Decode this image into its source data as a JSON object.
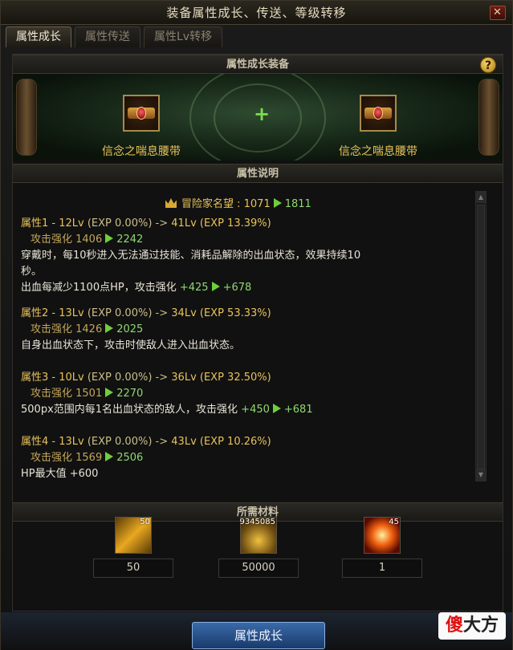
{
  "window": {
    "title": "装备属性成长、传送、等级转移"
  },
  "tabs": [
    {
      "label": "属性成长",
      "active": true
    },
    {
      "label": "属性传送",
      "active": false
    },
    {
      "label": "属性Lv转移",
      "active": false
    }
  ],
  "equip": {
    "header": "属性成长装备",
    "help": "?",
    "plus": "+",
    "left_item": "信念之喘息腰带",
    "right_item": "信念之喘息腰带"
  },
  "desc": {
    "header": "属性说明",
    "reputation": {
      "label": "冒险家名望 : 1071",
      "to": "1811"
    },
    "attrs": [
      {
        "head": "属性1 - 12Lv",
        "exp_from": "(EXP 0.00%)",
        "arrow": "->",
        "to": "41Lv (EXP 13.39%)",
        "stat": "攻击强化 1406",
        "stat_to": "2242",
        "lines": [
          "穿戴时，每10秒进入无法通过技能、消耗品解除的出血状态，效果持续10",
          "秒。"
        ],
        "extra": "出血每减少1100点HP，攻击强化",
        "extra_from": "+425",
        "extra_to": "+678"
      },
      {
        "head": "属性2 - 13Lv",
        "exp_from": "(EXP 0.00%)",
        "arrow": "->",
        "to": "34Lv (EXP 53.33%)",
        "stat": "攻击强化 1426",
        "stat_to": "2025",
        "lines": [
          "自身出血状态下，攻击时使敌人进入出血状态。"
        ]
      },
      {
        "head": "属性3 - 10Lv",
        "exp_from": "(EXP 0.00%)",
        "arrow": "->",
        "to": "36Lv (EXP 32.50%)",
        "stat": "攻击强化 1501",
        "stat_to": "2270",
        "extra": "500px范围内每1名出血状态的敌人，攻击强化",
        "extra_from": "+450",
        "extra_to": "+681"
      },
      {
        "head": "属性4 - 13Lv",
        "exp_from": "(EXP 0.00%)",
        "arrow": "->",
        "to": "43Lv (EXP 10.26%)",
        "stat": "攻击强化 1569",
        "stat_to": "2506",
        "lines": [
          "HP最大值 +600"
        ]
      }
    ]
  },
  "materials": {
    "header": "所需材料",
    "items": [
      {
        "icon": "gold-bar-icon",
        "badge": "50",
        "value": "50"
      },
      {
        "icon": "gold-coins-icon",
        "badge": "9345085",
        "value": "50000"
      },
      {
        "icon": "fire-orb-icon",
        "badge": "45",
        "value": "1"
      }
    ]
  },
  "footer": {
    "button": "属性成长"
  },
  "watermark": {
    "red": "傻",
    "black": "大方"
  }
}
